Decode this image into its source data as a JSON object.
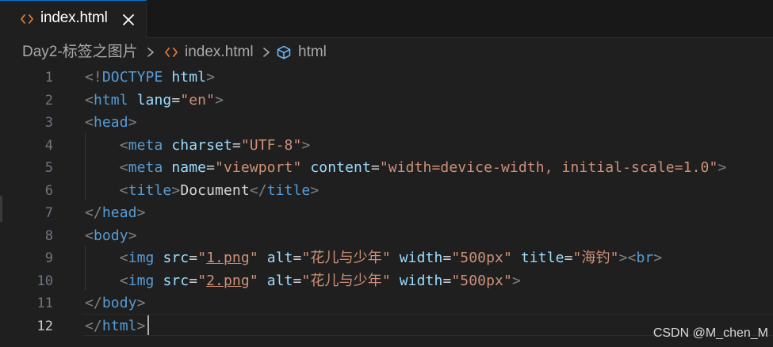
{
  "tab": {
    "label": "index.html",
    "icon": "html-brackets-icon",
    "close_icon": "close-icon"
  },
  "breadcrumb": {
    "items": [
      {
        "label": "Day2-标签之图片"
      },
      {
        "label": "index.html",
        "icon": "html-brackets-icon"
      },
      {
        "label": "html",
        "icon": "cube-icon"
      }
    ]
  },
  "editor": {
    "active_line": 12,
    "lines": [
      {
        "num": "1",
        "tokens": [
          {
            "t": "<!",
            "c": "punc"
          },
          {
            "t": "DOCTYPE",
            "c": "tag"
          },
          {
            "t": " ",
            "c": "text"
          },
          {
            "t": "html",
            "c": "attr"
          },
          {
            "t": ">",
            "c": "punc"
          }
        ]
      },
      {
        "num": "2",
        "tokens": [
          {
            "t": "<",
            "c": "punc"
          },
          {
            "t": "html",
            "c": "tag"
          },
          {
            "t": " ",
            "c": "text"
          },
          {
            "t": "lang",
            "c": "attr"
          },
          {
            "t": "=",
            "c": "eq"
          },
          {
            "t": "\"en\"",
            "c": "str"
          },
          {
            "t": ">",
            "c": "punc"
          }
        ]
      },
      {
        "num": "3",
        "tokens": [
          {
            "t": "<",
            "c": "punc"
          },
          {
            "t": "head",
            "c": "tag"
          },
          {
            "t": ">",
            "c": "punc"
          }
        ]
      },
      {
        "num": "4",
        "tokens": [
          {
            "t": "    ",
            "c": "text"
          },
          {
            "t": "<",
            "c": "punc"
          },
          {
            "t": "meta",
            "c": "tag"
          },
          {
            "t": " ",
            "c": "text"
          },
          {
            "t": "charset",
            "c": "attr"
          },
          {
            "t": "=",
            "c": "eq"
          },
          {
            "t": "\"UTF-8\"",
            "c": "str"
          },
          {
            "t": ">",
            "c": "punc"
          }
        ]
      },
      {
        "num": "5",
        "tokens": [
          {
            "t": "    ",
            "c": "text"
          },
          {
            "t": "<",
            "c": "punc"
          },
          {
            "t": "meta",
            "c": "tag"
          },
          {
            "t": " ",
            "c": "text"
          },
          {
            "t": "name",
            "c": "attr"
          },
          {
            "t": "=",
            "c": "eq"
          },
          {
            "t": "\"viewport\"",
            "c": "str"
          },
          {
            "t": " ",
            "c": "text"
          },
          {
            "t": "content",
            "c": "attr"
          },
          {
            "t": "=",
            "c": "eq"
          },
          {
            "t": "\"width=device-width, initial-scale=1.0\"",
            "c": "str"
          },
          {
            "t": ">",
            "c": "punc"
          }
        ]
      },
      {
        "num": "6",
        "tokens": [
          {
            "t": "    ",
            "c": "text"
          },
          {
            "t": "<",
            "c": "punc"
          },
          {
            "t": "title",
            "c": "tag"
          },
          {
            "t": ">",
            "c": "punc"
          },
          {
            "t": "Document",
            "c": "text"
          },
          {
            "t": "</",
            "c": "punc"
          },
          {
            "t": "title",
            "c": "tag"
          },
          {
            "t": ">",
            "c": "punc"
          }
        ]
      },
      {
        "num": "7",
        "tokens": [
          {
            "t": "</",
            "c": "punc"
          },
          {
            "t": "head",
            "c": "tag"
          },
          {
            "t": ">",
            "c": "punc"
          }
        ]
      },
      {
        "num": "8",
        "tokens": [
          {
            "t": "<",
            "c": "punc"
          },
          {
            "t": "body",
            "c": "tag"
          },
          {
            "t": ">",
            "c": "punc"
          }
        ]
      },
      {
        "num": "9",
        "tokens": [
          {
            "t": "    ",
            "c": "text"
          },
          {
            "t": "<",
            "c": "punc"
          },
          {
            "t": "img",
            "c": "tag"
          },
          {
            "t": " ",
            "c": "text"
          },
          {
            "t": "src",
            "c": "attr"
          },
          {
            "t": "=",
            "c": "eq"
          },
          {
            "t": "\"",
            "c": "str"
          },
          {
            "t": "1.png",
            "c": "str link"
          },
          {
            "t": "\"",
            "c": "str"
          },
          {
            "t": " ",
            "c": "text"
          },
          {
            "t": "alt",
            "c": "attr"
          },
          {
            "t": "=",
            "c": "eq"
          },
          {
            "t": "\"花儿与少年\"",
            "c": "str"
          },
          {
            "t": " ",
            "c": "text"
          },
          {
            "t": "width",
            "c": "attr"
          },
          {
            "t": "=",
            "c": "eq"
          },
          {
            "t": "\"500px\"",
            "c": "str"
          },
          {
            "t": " ",
            "c": "text"
          },
          {
            "t": "title",
            "c": "attr"
          },
          {
            "t": "=",
            "c": "eq"
          },
          {
            "t": "\"海钓\"",
            "c": "str"
          },
          {
            "t": "><",
            "c": "punc"
          },
          {
            "t": "br",
            "c": "tag"
          },
          {
            "t": ">",
            "c": "punc"
          }
        ]
      },
      {
        "num": "10",
        "tokens": [
          {
            "t": "    ",
            "c": "text"
          },
          {
            "t": "<",
            "c": "punc"
          },
          {
            "t": "img",
            "c": "tag"
          },
          {
            "t": " ",
            "c": "text"
          },
          {
            "t": "src",
            "c": "attr"
          },
          {
            "t": "=",
            "c": "eq"
          },
          {
            "t": "\"",
            "c": "str"
          },
          {
            "t": "2.png",
            "c": "str link"
          },
          {
            "t": "\"",
            "c": "str"
          },
          {
            "t": " ",
            "c": "text"
          },
          {
            "t": "alt",
            "c": "attr"
          },
          {
            "t": "=",
            "c": "eq"
          },
          {
            "t": "\"花儿与少年\"",
            "c": "str"
          },
          {
            "t": " ",
            "c": "text"
          },
          {
            "t": "width",
            "c": "attr"
          },
          {
            "t": "=",
            "c": "eq"
          },
          {
            "t": "\"500px\"",
            "c": "str"
          },
          {
            "t": ">",
            "c": "punc"
          }
        ]
      },
      {
        "num": "11",
        "tokens": [
          {
            "t": "</",
            "c": "punc"
          },
          {
            "t": "body",
            "c": "tag"
          },
          {
            "t": ">",
            "c": "punc"
          }
        ]
      },
      {
        "num": "12",
        "tokens": [
          {
            "t": "</",
            "c": "punc"
          },
          {
            "t": "html",
            "c": "tag"
          },
          {
            "t": ">",
            "c": "punc"
          }
        ]
      }
    ]
  },
  "watermark": "CSDN @M_chen_M",
  "colors": {
    "tag": "#569cd6",
    "attr": "#9cdcfe",
    "string": "#ce9178",
    "punctuation": "#808080",
    "text": "#d4d4d4",
    "accent": "#0078d4"
  }
}
